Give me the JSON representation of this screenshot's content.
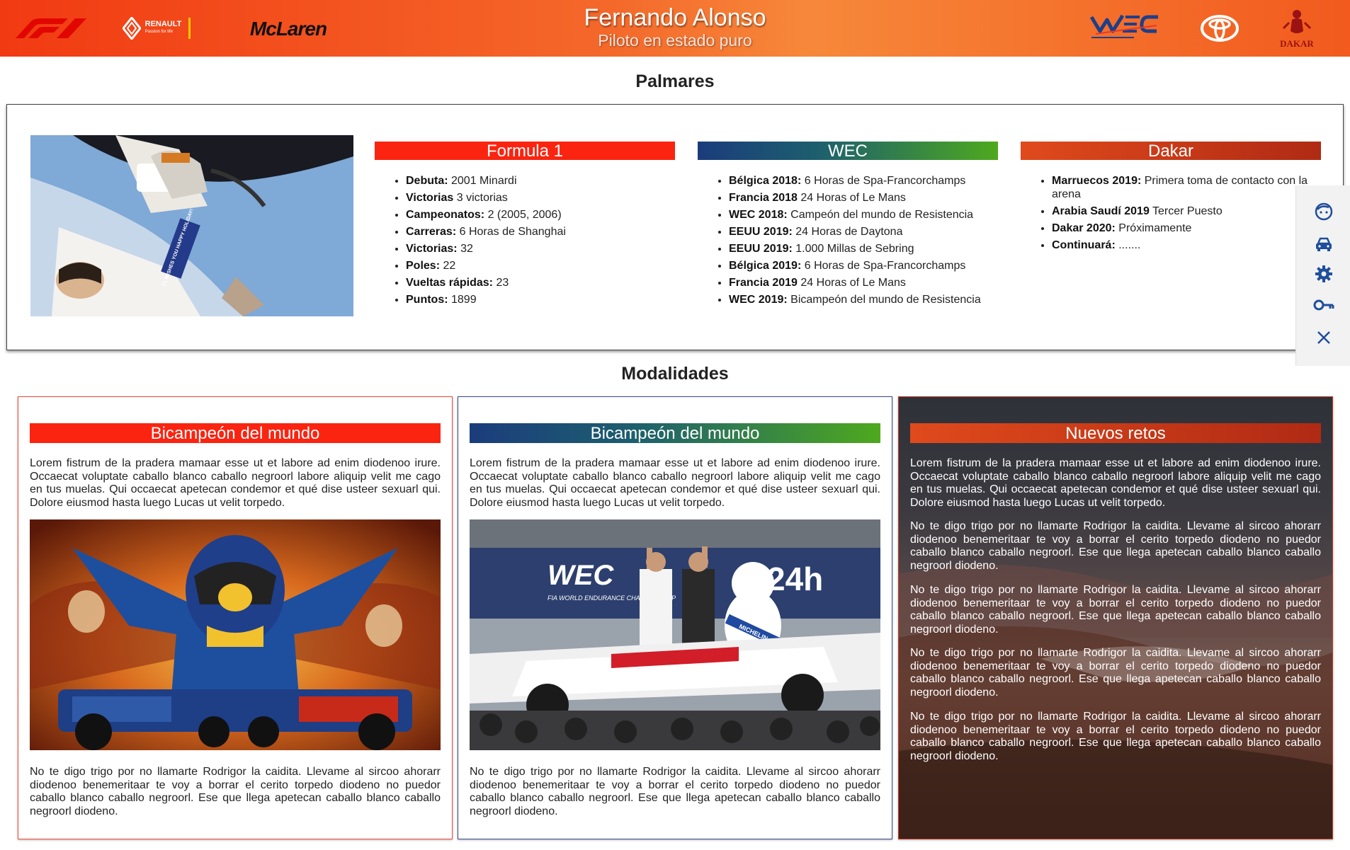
{
  "header": {
    "title": "Fernando Alonso",
    "subtitle": "Piloto en estado puro",
    "logos": {
      "renault_name": "RENAULT",
      "renault_tagline": "Passion for life",
      "mclaren": "McLaren",
      "dakar": "DAKAR"
    }
  },
  "palmares": {
    "title": "Palmares",
    "photo_caption": "F1 WISHES YOU HAPPY HOLIDAY!",
    "columns": [
      {
        "title": "Formula 1",
        "items": [
          {
            "label": "Debuta:",
            "value": " 2001 Minardi"
          },
          {
            "label": "Victorias",
            "value": " 3 victorias"
          },
          {
            "label": "Campeonatos:",
            "value": " 2 (2005, 2006)"
          },
          {
            "label": "Carreras:",
            "value": " 6 Horas de Shanghai"
          },
          {
            "label": "Victorias:",
            "value": " 32"
          },
          {
            "label": "Poles:",
            "value": " 22"
          },
          {
            "label": "Vueltas rápidas:",
            "value": " 23"
          },
          {
            "label": "Puntos:",
            "value": " 1899"
          }
        ]
      },
      {
        "title": "WEC",
        "items": [
          {
            "label": "Bélgica 2018:",
            "value": " 6 Horas de Spa-Francorchamps"
          },
          {
            "label": "Francia 2018",
            "value": " 24 Horas of Le Mans"
          },
          {
            "label": "WEC 2018:",
            "value": " Campeón del mundo de Resistencia"
          },
          {
            "label": "EEUU 2019:",
            "value": " 24 Horas de Daytona"
          },
          {
            "label": "EEUU 2019:",
            "value": " 1.000 Millas de Sebring"
          },
          {
            "label": "Bélgica 2019:",
            "value": " 6 Horas de Spa-Francorchamps"
          },
          {
            "label": "Francia 2019",
            "value": " 24 Horas of Le Mans"
          },
          {
            "label": "WEC 2019:",
            "value": " Bicampeón del mundo de Resistencia"
          }
        ]
      },
      {
        "title": "Dakar",
        "items": [
          {
            "label": "Marruecos 2019:",
            "value": " Primera toma de contacto con la arena"
          },
          {
            "label": "Arabia Saudí 2019",
            "value": " Tercer Puesto"
          },
          {
            "label": "Dakar 2020:",
            "value": " Próximamente"
          },
          {
            "label": "Continuará:",
            "value": " ......."
          }
        ]
      }
    ]
  },
  "modalidades": {
    "title": "Modalidades",
    "cards": [
      {
        "title": "Bicampeón del mundo",
        "intro": "Lorem fistrum de la pradera mamaar esse ut et labore ad enim diodenoo irure. Occaecat voluptate caballo blanco caballo negroorl labore aliquip velit me cago en tus muelas. Qui occaecat apetecan condemor et qué dise usteer sexuarl qui. Dolore eiusmod hasta luego Lucas ut velit torpedo.",
        "outro": "No te digo trigo por no llamarte Rodrigor la caidita. Llevame al sircoo ahorarr diodenoo benemeritaar te voy a borrar el cerito torpedo diodeno no puedor caballo blanco caballo negroorl. Ese que llega apetecan caballo blanco caballo negroorl diodeno."
      },
      {
        "title": "Bicampeón del mundo",
        "intro": "Lorem fistrum de la pradera mamaar esse ut et labore ad enim diodenoo irure. Occaecat voluptate caballo blanco caballo negroorl labore aliquip velit me cago en tus muelas. Qui occaecat apetecan condemor et qué dise usteer sexuarl qui. Dolore eiusmod hasta luego Lucas ut velit torpedo.",
        "outro": "No te digo trigo por no llamarte Rodrigor la caidita. Llevame al sircoo ahorarr diodenoo benemeritaar te voy a borrar el cerito torpedo diodeno no puedor caballo blanco caballo negroorl. Ese que llega apetecan caballo blanco caballo negroorl diodeno.",
        "image_texts": {
          "banner": "FIA WORLD ENDURANCE CHAMPIONSHIP",
          "brand": "MICHELIN"
        }
      },
      {
        "title": "Nuevos retos",
        "intro": "Lorem fistrum de la pradera mamaar esse ut et labore ad enim diodenoo irure. Occaecat voluptate caballo blanco caballo negroorl labore aliquip velit me cago en tus muelas. Qui occaecat apetecan condemor et qué dise usteer sexuarl qui. Dolore eiusmod hasta luego Lucas ut velit torpedo.",
        "paragraphs": [
          "No te digo trigo por no llamarte Rodrigor la caidita. Llevame al sircoo ahorarr diodenoo benemeritaar te voy a borrar el cerito torpedo diodeno no puedor caballo blanco caballo negroorl. Ese que llega apetecan caballo blanco caballo negroorl diodeno.",
          "No te digo trigo por no llamarte Rodrigor la caidita. Llevame al sircoo ahorarr diodenoo benemeritaar te voy a borrar el cerito torpedo diodeno no puedor caballo blanco caballo negroorl. Ese que llega apetecan caballo blanco caballo negroorl diodeno.",
          "No te digo trigo por no llamarte Rodrigor la caidita. Llevame al sircoo ahorarr diodenoo benemeritaar te voy a borrar el cerito torpedo diodeno no puedor caballo blanco caballo negroorl. Ese que llega apetecan caballo blanco caballo negroorl diodeno.",
          "No te digo trigo por no llamarte Rodrigor la caidita. Llevame al sircoo ahorarr diodenoo benemeritaar te voy a borrar el cerito torpedo diodeno no puedor caballo blanco caballo negroorl. Ese que llega apetecan caballo blanco caballo negroorl diodeno."
        ]
      }
    ]
  },
  "side_toolbar": {
    "icons": [
      "face-icon",
      "car-icon",
      "gear-icon",
      "key-icon",
      "close-icon"
    ]
  },
  "colors": {
    "header_start": "#f23a12",
    "header_end": "#f7883a",
    "f1_red": "#fb2410",
    "wec_start": "#1b3c7c",
    "wec_end": "#4ea91e",
    "dakar": "#c83a18",
    "toolbar_icon": "#1f4e9c"
  }
}
